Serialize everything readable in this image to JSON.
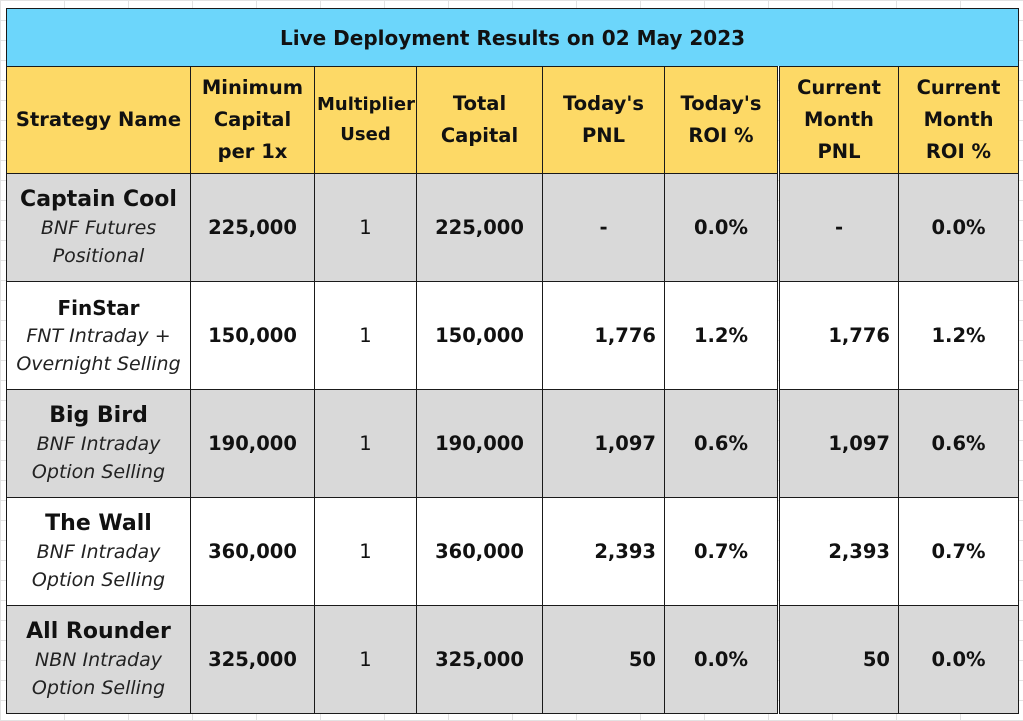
{
  "title": "Live Deployment Results on 02 May 2023",
  "headers": {
    "strategy_name": "Strategy Name",
    "min_capital": "Minimum Capital per 1x",
    "multiplier": "Multiplier Used",
    "total_capital": "Total Capital",
    "todays_pnl": "Today's PNL",
    "todays_roi": "Today's ROI %",
    "month_pnl": "Current Month PNL",
    "month_roi": "Current Month ROI %"
  },
  "rows": [
    {
      "name": "Captain Cool",
      "desc_line1": "BNF Futures",
      "desc_line2": "Positional",
      "min_capital": "225,000",
      "multiplier": "1",
      "total_capital": "225,000",
      "todays_pnl": "-",
      "todays_roi": "0.0%",
      "month_pnl": "-",
      "month_roi": "0.0%"
    },
    {
      "name": "FinStar",
      "desc_line1": "FNT Intraday +",
      "desc_line2": "Overnight Selling",
      "min_capital": "150,000",
      "multiplier": "1",
      "total_capital": "150,000",
      "todays_pnl": "1,776",
      "todays_roi": "1.2%",
      "month_pnl": "1,776",
      "month_roi": "1.2%"
    },
    {
      "name": "Big Bird",
      "desc_line1": "BNF Intraday",
      "desc_line2": "Option Selling",
      "min_capital": "190,000",
      "multiplier": "1",
      "total_capital": "190,000",
      "todays_pnl": "1,097",
      "todays_roi": "0.6%",
      "month_pnl": "1,097",
      "month_roi": "0.6%"
    },
    {
      "name": "The Wall",
      "desc_line1": "BNF Intraday",
      "desc_line2": "Option Selling",
      "min_capital": "360,000",
      "multiplier": "1",
      "total_capital": "360,000",
      "todays_pnl": "2,393",
      "todays_roi": "0.7%",
      "month_pnl": "2,393",
      "month_roi": "0.7%"
    },
    {
      "name": "All Rounder",
      "desc_line1": "NBN Intraday",
      "desc_line2": "Option Selling",
      "min_capital": "325,000",
      "multiplier": "1",
      "total_capital": "325,000",
      "todays_pnl": "50",
      "todays_roi": "0.0%",
      "month_pnl": "50",
      "month_roi": "0.0%"
    }
  ],
  "colors": {
    "title_bg": "#6cd6fb",
    "header_bg": "#fdd966",
    "shaded_row_bg": "#d9d9d9",
    "plain_row_bg": "#ffffff"
  }
}
